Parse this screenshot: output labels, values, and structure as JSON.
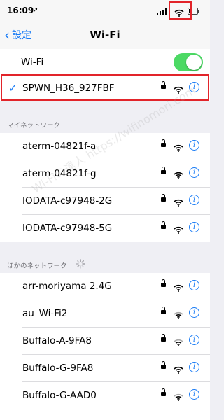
{
  "status_bar": {
    "time": "16:09"
  },
  "nav": {
    "back_label": "設定",
    "title": "Wi-Fi"
  },
  "wifi_toggle": {
    "label": "Wi-Fi",
    "on": true
  },
  "current_network": {
    "name": "SPWN_H36_927FBF"
  },
  "sections": {
    "my_networks": "マイネットワーク",
    "other_networks": "ほかのネットワーク"
  },
  "my_networks": [
    {
      "name": "aterm-04821f-a"
    },
    {
      "name": "aterm-04821f-g"
    },
    {
      "name": "IODATA-c97948-2G"
    },
    {
      "name": "IODATA-c97948-5G"
    }
  ],
  "other_networks": [
    {
      "name": "arr-moriyama 2.4G"
    },
    {
      "name": "au_Wi-Fi2"
    },
    {
      "name": "Buffalo-A-9FA8"
    },
    {
      "name": "Buffalo-G-9FA8"
    },
    {
      "name": "Buffalo-G-AAD0"
    }
  ],
  "watermark": "Wi-Fiの達人 https://wifinomori.com",
  "colors": {
    "accent": "#1a7cf5",
    "toggle_on": "#4cd964",
    "highlight": "#e2242a"
  }
}
